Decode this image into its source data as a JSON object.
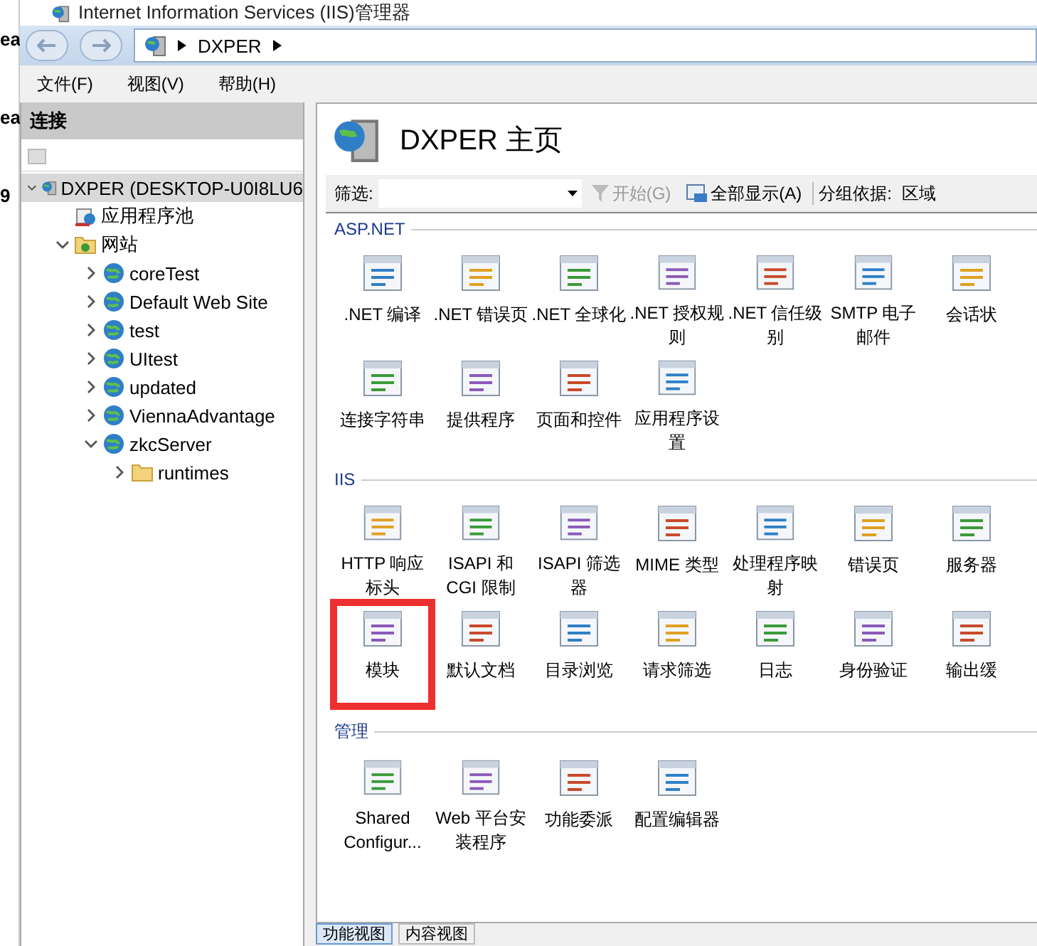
{
  "background_window": {
    "fragments": [
      "ea",
      "ea",
      "9"
    ]
  },
  "window": {
    "title": "Internet Information Services (IIS)管理器"
  },
  "address_bar": {
    "path": [
      "DXPER"
    ]
  },
  "menu": [
    "文件(F)",
    "视图(V)",
    "帮助(H)"
  ],
  "connections": {
    "title": "连接",
    "tree": [
      {
        "label": "DXPER (DESKTOP-U0I8LU6",
        "kind": "server",
        "expanded": true,
        "selected": true,
        "children": [
          {
            "label": "应用程序池",
            "kind": "pool",
            "selected": false
          },
          {
            "label": "网站",
            "kind": "sites",
            "expanded": true,
            "selected": false,
            "children": [
              {
                "label": "coreTest",
                "kind": "site",
                "expanded": false,
                "selected": false
              },
              {
                "label": "Default Web Site",
                "kind": "site",
                "expanded": false,
                "selected": false
              },
              {
                "label": "test",
                "kind": "site",
                "expanded": false,
                "selected": false
              },
              {
                "label": "UItest",
                "kind": "site",
                "expanded": false,
                "selected": false
              },
              {
                "label": "updated",
                "kind": "site",
                "expanded": false,
                "selected": false
              },
              {
                "label": "ViennaAdvantage",
                "kind": "site",
                "expanded": false,
                "selected": false
              },
              {
                "label": "zkcServer",
                "kind": "site",
                "expanded": true,
                "selected": false,
                "children": [
                  {
                    "label": "runtimes",
                    "kind": "folder",
                    "expanded": false,
                    "selected": false
                  }
                ]
              }
            ]
          }
        ]
      }
    ]
  },
  "home": {
    "title": "DXPER 主页",
    "filter": {
      "label": "筛选:",
      "go": "开始(G)",
      "go_disabled": true,
      "show_all": "全部显示(A)",
      "group_label": "分组依据:",
      "group_value": "区域"
    },
    "groups": [
      {
        "name": "ASP.NET",
        "features": [
          {
            "label": ".NET 编译",
            "highlighted": false
          },
          {
            "label": ".NET 错误页",
            "highlighted": false
          },
          {
            "label": ".NET 全球化",
            "highlighted": false
          },
          {
            "label": ".NET 授权规则",
            "highlighted": false
          },
          {
            "label": ".NET 信任级别",
            "highlighted": false
          },
          {
            "label": "SMTP 电子邮件",
            "highlighted": false
          },
          {
            "label": "会话状",
            "highlighted": false
          },
          {
            "label": "连接字符串",
            "highlighted": false
          },
          {
            "label": "提供程序",
            "highlighted": false
          },
          {
            "label": "页面和控件",
            "highlighted": false
          },
          {
            "label": "应用程序设置",
            "highlighted": false
          }
        ]
      },
      {
        "name": "IIS",
        "features": [
          {
            "label": "HTTP 响应标头",
            "highlighted": false
          },
          {
            "label": "ISAPI 和 CGI 限制",
            "highlighted": false
          },
          {
            "label": "ISAPI 筛选器",
            "highlighted": false
          },
          {
            "label": "MIME 类型",
            "highlighted": false
          },
          {
            "label": "处理程序映射",
            "highlighted": false
          },
          {
            "label": "错误页",
            "highlighted": false
          },
          {
            "label": "服务器",
            "highlighted": false
          },
          {
            "label": "模块",
            "highlighted": true
          },
          {
            "label": "默认文档",
            "highlighted": false
          },
          {
            "label": "目录浏览",
            "highlighted": false
          },
          {
            "label": "请求筛选",
            "highlighted": false
          },
          {
            "label": "日志",
            "highlighted": false
          },
          {
            "label": "身份验证",
            "highlighted": false
          },
          {
            "label": "输出缓",
            "highlighted": false
          }
        ]
      },
      {
        "name": "管理",
        "features": [
          {
            "label": "Shared Configur...",
            "highlighted": false
          },
          {
            "label": "Web 平台安装程序",
            "highlighted": false
          },
          {
            "label": "功能委派",
            "highlighted": false
          },
          {
            "label": "配置编辑器",
            "highlighted": false
          }
        ]
      }
    ]
  },
  "view_tabs": [
    {
      "label": "功能视图",
      "selected": true
    },
    {
      "label": "内容视图",
      "selected": false
    }
  ]
}
